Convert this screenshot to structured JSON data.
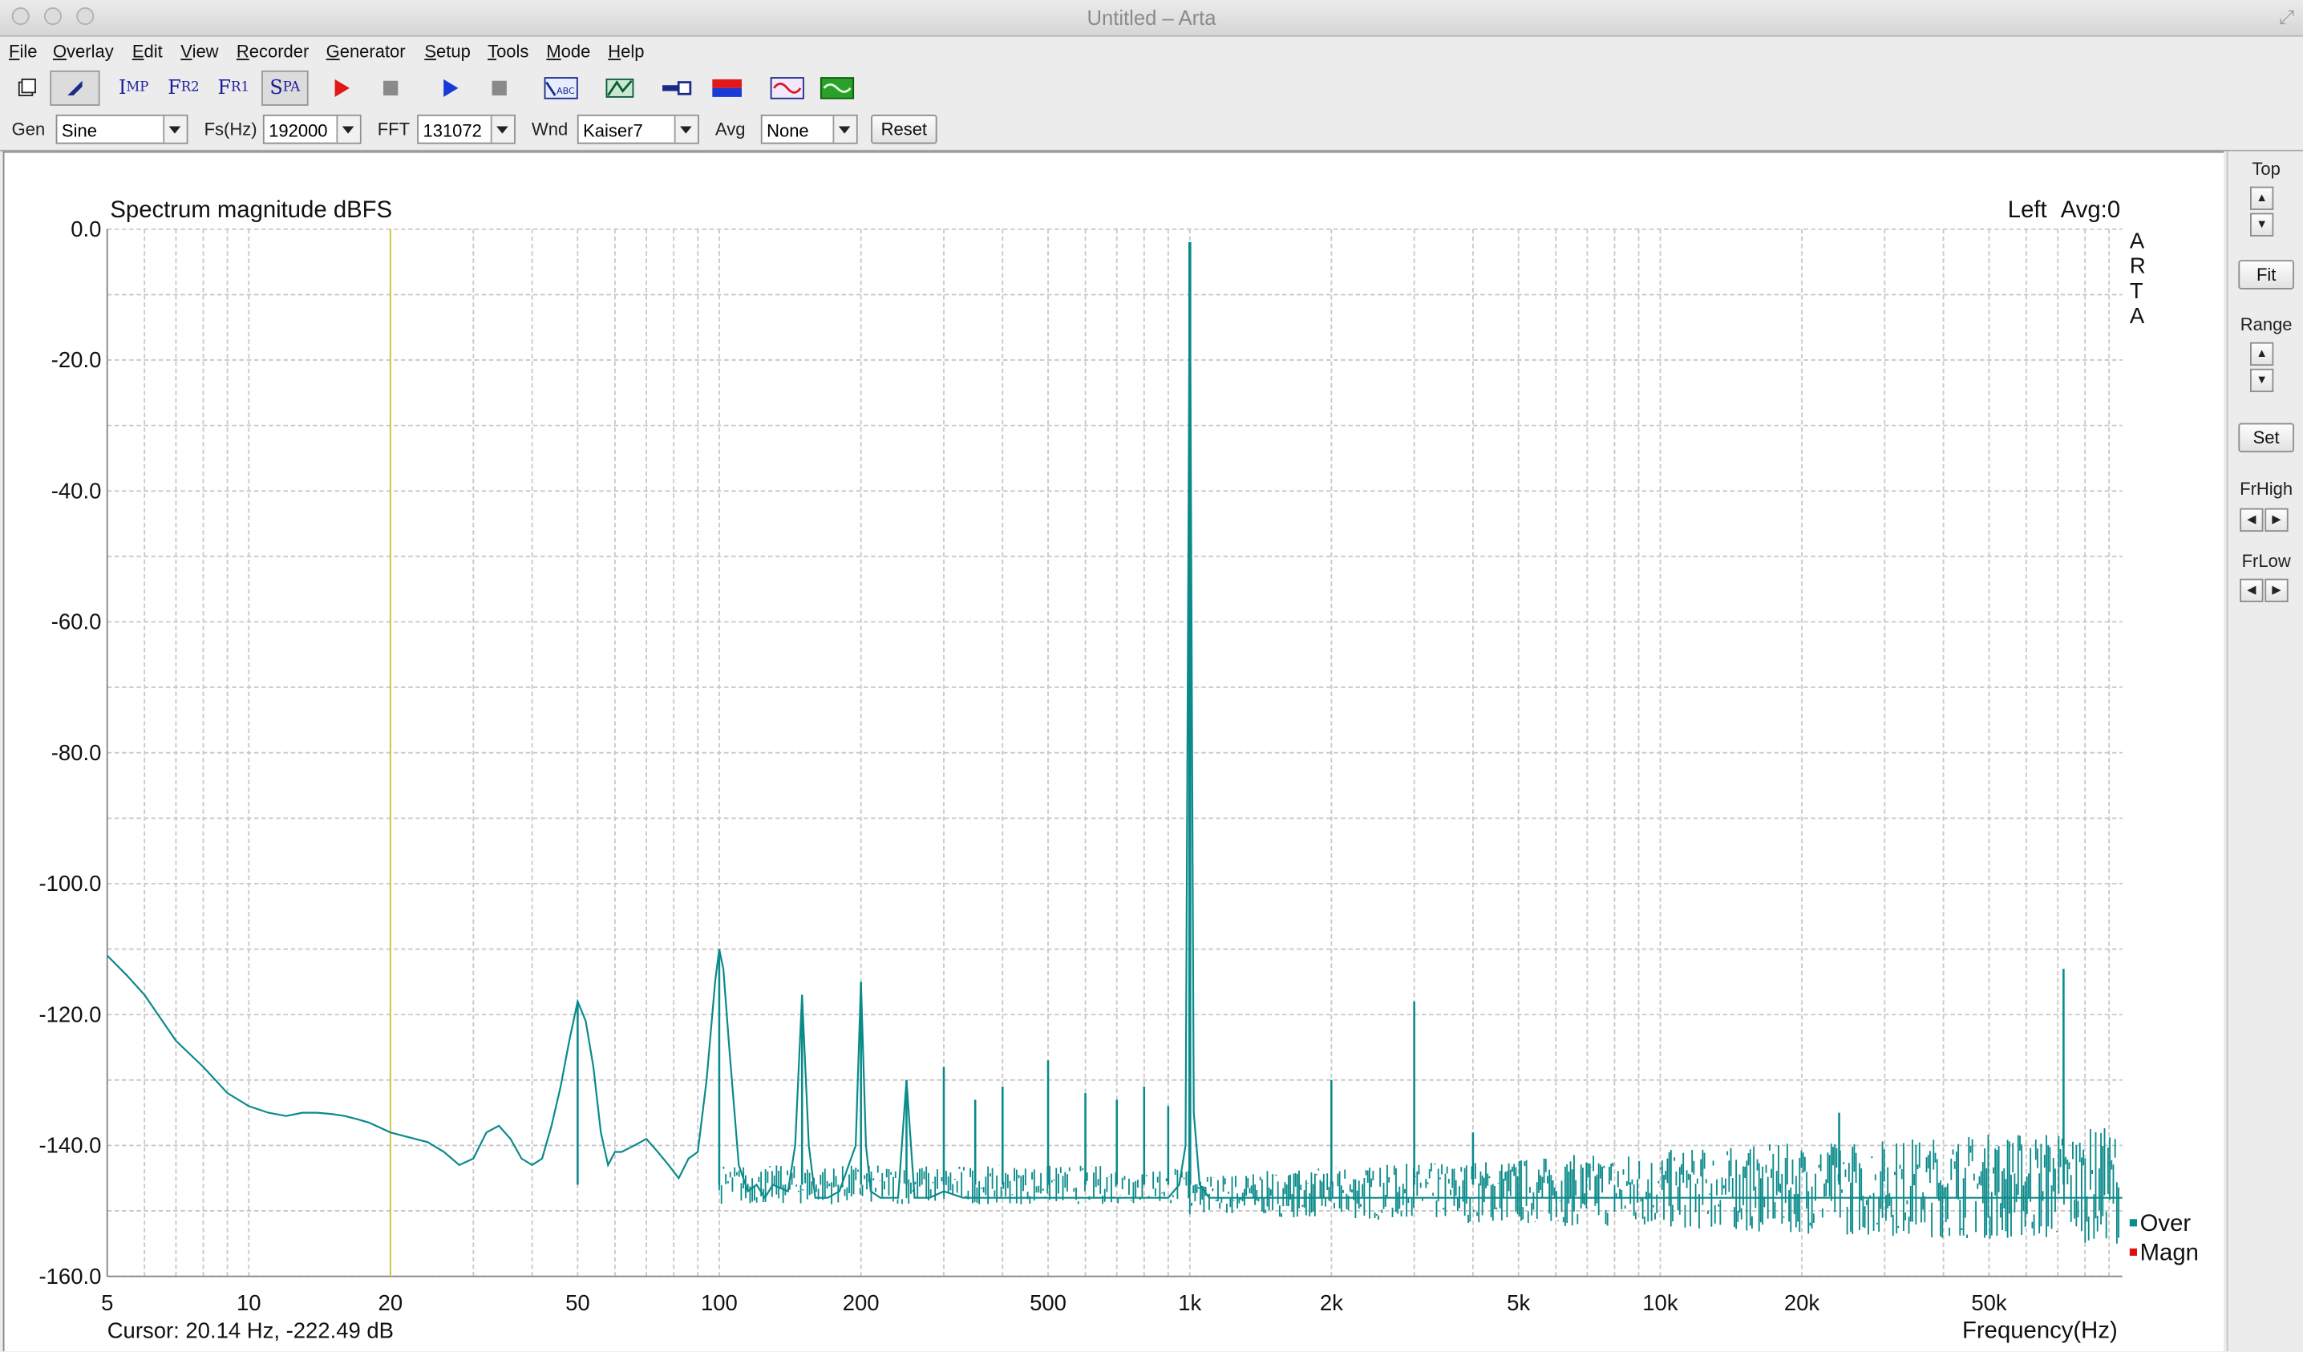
{
  "window": {
    "title": "Untitled – Arta"
  },
  "menu": [
    "File",
    "Overlay",
    "Edit",
    "View",
    "Recorder",
    "Generator",
    "Setup",
    "Tools",
    "Mode",
    "Help"
  ],
  "toolbar": {
    "imp": {
      "big": "I",
      "small": "MP"
    },
    "fr2": {
      "big": "F",
      "small": "R2"
    },
    "fr1": {
      "big": "F",
      "small": "R1"
    },
    "spa": {
      "big": "S",
      "small": "PA"
    },
    "abc": "ABC"
  },
  "params": {
    "gen": {
      "label": "Gen",
      "value": "Sine"
    },
    "fs": {
      "label": "Fs(Hz)",
      "value": "192000"
    },
    "fft": {
      "label": "FFT",
      "value": "131072"
    },
    "wnd": {
      "label": "Wnd",
      "value": "Kaiser7"
    },
    "avg": {
      "label": "Avg",
      "value": "None"
    },
    "reset_label": "Reset"
  },
  "plot": {
    "channel": "Left",
    "avg_status": "Avg:0",
    "logo": "A\nR\nT\nA",
    "cursor": "Cursor: 20.14 Hz, -222.49 dB",
    "cursor_x": 20,
    "legend": [
      {
        "name": "Over",
        "color": "#0a8a8a"
      },
      {
        "name": "Magn",
        "color": "#e01010"
      }
    ]
  },
  "sidebar": {
    "top": "Top",
    "fit": "Fit",
    "range": "Range",
    "set": "Set",
    "frhigh": "FrHigh",
    "frlow": "FrLow",
    "up": "▲",
    "down": "▼",
    "left": "◀",
    "right": "▶"
  },
  "colors": {
    "trace": "#0a8a8a",
    "cursor": "#c8c832",
    "grid": "#c8c8c8"
  },
  "chart_data": {
    "type": "line",
    "title": "Spectrum magnitude dBFS",
    "xlabel": "Frequency(Hz)",
    "ylabel": "",
    "x_scale": "log",
    "xlim": [
      5,
      96000
    ],
    "ylim": [
      -160,
      0
    ],
    "grid": true,
    "x_ticks": [
      5,
      10,
      20,
      50,
      100,
      200,
      500,
      1000,
      2000,
      5000,
      10000,
      20000,
      50000
    ],
    "x_tick_labels": [
      "5",
      "10",
      "20",
      "50",
      "100",
      "200",
      "500",
      "1k",
      "2k",
      "5k",
      "10k",
      "20k",
      "50k"
    ],
    "y_ticks": [
      0,
      -20,
      -40,
      -60,
      -80,
      -100,
      -120,
      -140,
      -160
    ],
    "y_tick_labels": [
      "0.0",
      "-20.0",
      "-40.0",
      "-60.0",
      "-80.0",
      "-100.0",
      "-120.0",
      "-140.0",
      "-160.0"
    ],
    "series": [
      {
        "name": "Over",
        "x": [
          5,
          5.5,
          6,
          7,
          8,
          9,
          10,
          11,
          12,
          13,
          14,
          15,
          16,
          17,
          18,
          20,
          22,
          24,
          26,
          28,
          30,
          32,
          34,
          36,
          38,
          40,
          42,
          44,
          46,
          48,
          50,
          52,
          54,
          56,
          58,
          60,
          62,
          66,
          70,
          74,
          78,
          82,
          86,
          90,
          94,
          98,
          100,
          102,
          105,
          110,
          115,
          120,
          125,
          130,
          140,
          145,
          150,
          155,
          160,
          170,
          180,
          195,
          200,
          205,
          210,
          220,
          240,
          250,
          260,
          280,
          300,
          330,
          360,
          400,
          440,
          480,
          500,
          520,
          560,
          600,
          660,
          700,
          740,
          800,
          850,
          900,
          950,
          980,
          1000,
          1020,
          1050,
          1100,
          1300,
          1500,
          1800,
          2000,
          2500,
          3000,
          4000,
          5000,
          7000,
          10000,
          15000,
          20000,
          24000,
          30000,
          40000,
          50000,
          60000,
          70000,
          75000,
          80000,
          85000,
          90000,
          96000
        ],
        "y": [
          -111,
          -114,
          -117,
          -124,
          -128,
          -132,
          -134,
          -135,
          -135.5,
          -135,
          -135,
          -135.2,
          -135.5,
          -136,
          -136.5,
          -138,
          -138.8,
          -139.5,
          -141,
          -143,
          -142,
          -138,
          -137,
          -139,
          -142,
          -143,
          -142,
          -137,
          -131,
          -124,
          -118,
          -121,
          -128,
          -138,
          -143,
          -141,
          -141,
          -140,
          -139,
          -141,
          -143,
          -145,
          -142,
          -141,
          -130,
          -115,
          -110,
          -113,
          -125,
          -143,
          -147,
          -146,
          -148,
          -146,
          -147,
          -140,
          -117,
          -140,
          -148,
          -148,
          -147,
          -140,
          -115,
          -140,
          -147,
          -148,
          -148,
          -130,
          -148,
          -148,
          -147,
          -148,
          -148,
          -148,
          -148,
          -148,
          -148,
          -148,
          -148,
          -148,
          -148,
          -148,
          -148,
          -148,
          -148,
          -148,
          -146,
          -140,
          -2,
          -135,
          -146,
          -148,
          -148,
          -148,
          -148,
          -148,
          -148,
          -148,
          -148,
          -148,
          -148,
          -148,
          -148,
          -148,
          -148,
          -148,
          -148,
          -148,
          -148,
          -148,
          -148,
          -148,
          -148,
          -148,
          -148
        ]
      }
    ],
    "peaks": [
      {
        "x": 50,
        "y": -118
      },
      {
        "x": 100,
        "y": -110
      },
      {
        "x": 150,
        "y": -117
      },
      {
        "x": 200,
        "y": -115
      },
      {
        "x": 250,
        "y": -130
      },
      {
        "x": 300,
        "y": -128
      },
      {
        "x": 350,
        "y": -133
      },
      {
        "x": 400,
        "y": -131
      },
      {
        "x": 500,
        "y": -127
      },
      {
        "x": 600,
        "y": -132
      },
      {
        "x": 700,
        "y": -133
      },
      {
        "x": 800,
        "y": -131
      },
      {
        "x": 900,
        "y": -134
      },
      {
        "x": 1000,
        "y": -2
      },
      {
        "x": 2000,
        "y": -130
      },
      {
        "x": 3000,
        "y": -118
      },
      {
        "x": 4000,
        "y": -138
      },
      {
        "x": 24000,
        "y": -135
      },
      {
        "x": 72000,
        "y": -113
      }
    ]
  }
}
